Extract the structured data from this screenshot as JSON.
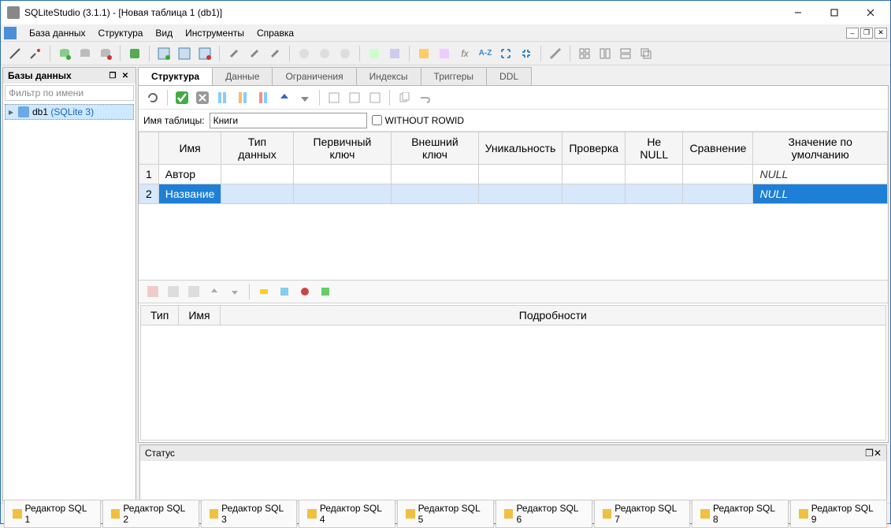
{
  "window": {
    "title": "SQLiteStudio (3.1.1) - [Новая таблица 1 (db1)]"
  },
  "menu": {
    "database": "База данных",
    "structure": "Структура",
    "view": "Вид",
    "tools": "Инструменты",
    "help": "Справка"
  },
  "side": {
    "title": "Базы данных",
    "filter_placeholder": "Фильтр по имени",
    "db_name": "db1",
    "db_type": "(SQLite 3)"
  },
  "tabs": {
    "structure": "Структура",
    "data": "Данные",
    "constraints": "Ограничения",
    "indexes": "Индексы",
    "triggers": "Триггеры",
    "ddl": "DDL"
  },
  "tablename": {
    "label": "Имя таблицы:",
    "value": "Книги",
    "without_rowid": "WITHOUT ROWID"
  },
  "cols": {
    "headers": {
      "name": "Имя",
      "datatype": "Тип данных",
      "pk": "Первичный ключ",
      "fk": "Внешний ключ",
      "unique": "Уникальность",
      "check": "Проверка",
      "notnull": "Не NULL",
      "collate": "Сравнение",
      "default": "Значение по умолчанию"
    },
    "rows": [
      {
        "num": "1",
        "name": "Автор",
        "default": "NULL"
      },
      {
        "num": "2",
        "name": "Название",
        "default": "NULL"
      }
    ]
  },
  "details": {
    "type": "Тип",
    "name": "Имя",
    "details": "Подробности"
  },
  "status": {
    "title": "Статус"
  },
  "editors": [
    "Редактор SQL 1",
    "Редактор SQL 2",
    "Редактор SQL 3",
    "Редактор SQL 4",
    "Редактор SQL 5",
    "Редактор SQL 6",
    "Редактор SQL 7",
    "Редактор SQL 8",
    "Редактор SQL 9"
  ]
}
